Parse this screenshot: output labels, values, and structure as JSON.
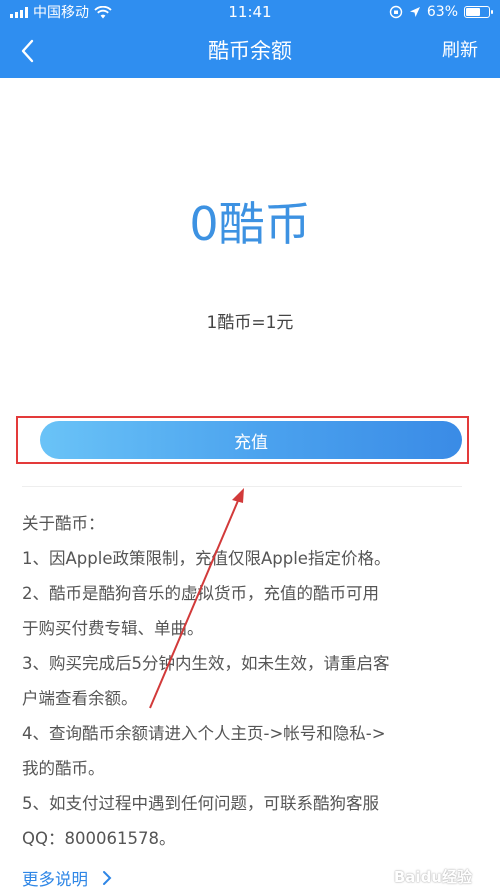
{
  "status_bar": {
    "carrier": "中国移动",
    "time": "11:41",
    "battery": "63%",
    "battery_level": 0.63
  },
  "nav": {
    "title": "酷币余额",
    "refresh": "刷新"
  },
  "balance": {
    "amount": "0酷币",
    "rate": "1酷币=1元"
  },
  "recharge_button": "充值",
  "info": {
    "heading": "关于酷币：",
    "lines": [
      "1、因Apple政策限制，充值仅限Apple指定价格。",
      "2、酷币是酷狗音乐的虚拟货币，充值的酷币可用",
      "于购买付费专辑、单曲。",
      "3、购买完成后5分钟内生效，如未生效，请重启客",
      "户端查看余额。",
      "4、查询酷币余额请进入个人主页->帐号和隐私->",
      "我的酷币。",
      "5、如支付过程中遇到任何问题，可联系酷狗客服",
      "QQ：800061578。"
    ]
  },
  "more_link": "更多说明",
  "watermark": "Baidu经验",
  "colors": {
    "primary": "#2f8ef0",
    "balance": "#3d92e2",
    "highlight_box": "#e33a3a",
    "link": "#2e86e6"
  }
}
